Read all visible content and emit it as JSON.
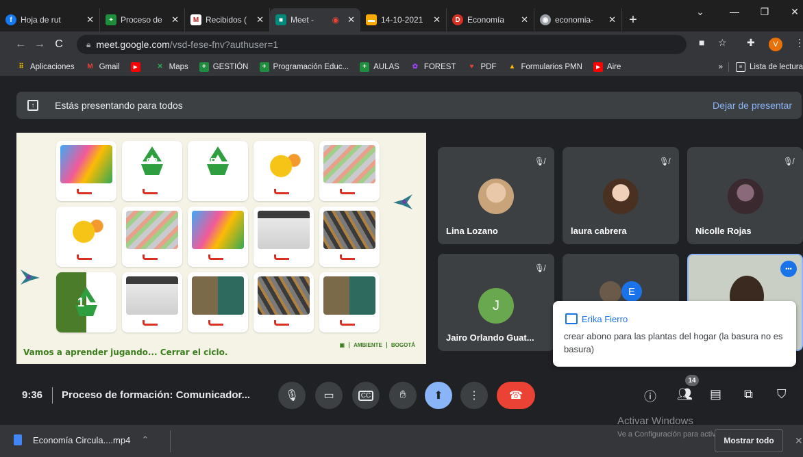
{
  "browser": {
    "tabs": [
      {
        "title": "Hoja de rut",
        "icon": "facebook-icon",
        "color": "#1877f2",
        "glyph": "f"
      },
      {
        "title": "Proceso de",
        "icon": "classroom-icon",
        "color": "#1e8e3e",
        "glyph": "+"
      },
      {
        "title": "Recibidos (",
        "icon": "gmail-icon",
        "color": "#c5221f",
        "glyph": "M"
      },
      {
        "title": "Meet -",
        "icon": "meet-icon",
        "color": "#00897b",
        "glyph": "■",
        "active": true
      },
      {
        "title": "14-10-2021",
        "icon": "document-icon",
        "color": "#f9ab00",
        "glyph": "▬"
      },
      {
        "title": "Economía",
        "icon": "d-icon",
        "color": "#d93025",
        "glyph": "D"
      },
      {
        "title": "economia-",
        "icon": "web-icon",
        "color": "#9aa0a6",
        "glyph": "◉"
      }
    ],
    "new_tab_label": "+",
    "url_host": "meet.google.com",
    "url_path": "/vsd-fese-fnv?authuser=1",
    "profile_initial": "V",
    "bookmarks": [
      {
        "label": "Aplicaciones",
        "icon": "apps-grid-icon",
        "color": "#4285f4",
        "glyph": "⠿"
      },
      {
        "label": "Gmail",
        "icon": "gmail-icon",
        "color": "#ea4335",
        "glyph": "M"
      },
      {
        "label": "",
        "icon": "youtube-icon",
        "color": "#ff0000",
        "glyph": "▶"
      },
      {
        "label": "Maps",
        "icon": "maps-icon",
        "color": "#34a853",
        "glyph": "✕"
      },
      {
        "label": "GESTIÓN",
        "icon": "classroom-icon",
        "color": "#1e8e3e",
        "glyph": "+"
      },
      {
        "label": "Programación Educ...",
        "icon": "classroom-icon",
        "color": "#1e8e3e",
        "glyph": "+"
      },
      {
        "label": "AULAS",
        "icon": "classroom-icon",
        "color": "#1e8e3e",
        "glyph": "+"
      },
      {
        "label": "FOREST",
        "icon": "forest-icon",
        "color": "#a142f4",
        "glyph": "✿"
      },
      {
        "label": "PDF",
        "icon": "pdf-icon",
        "color": "#ea4335",
        "glyph": "♥"
      },
      {
        "label": "Formularios PMN",
        "icon": "drive-icon",
        "color": "#fbbc04",
        "glyph": "▲"
      },
      {
        "label": "Aire",
        "icon": "youtube-icon",
        "color": "#ff0000",
        "glyph": "▶"
      }
    ],
    "more_bookmarks": "»",
    "reading_list": "Lista de lectura"
  },
  "meet": {
    "presenting_text": "Estás presentando para todos",
    "stop_presenting": "Dejar de presentar",
    "slide": {
      "caption": "Vamos a aprender jugando... Cerrar el ciclo.",
      "logo_ambiente": "AMBIENTE",
      "logo_bogota": "BOGOTÁ",
      "recycle_label": "9R",
      "partial_label": "1"
    },
    "participants": [
      {
        "name": "Lina Lozano",
        "muted": true
      },
      {
        "name": "laura cabrera",
        "muted": true
      },
      {
        "name": "Nicolle Rojas",
        "muted": true
      },
      {
        "name": "Jairo Orlando Guat...",
        "muted": true,
        "initial": "J"
      },
      {
        "name": "",
        "initial": "E"
      },
      {
        "name": "",
        "more": "•••"
      }
    ],
    "chat": {
      "sender": "Erika Fierro",
      "message": "crear abono para las plantas del hogar (la basura no es basura)"
    },
    "time": "9:36",
    "meeting_title": "Proceso de formación: Comunicador...",
    "people_count": "14"
  },
  "windows": {
    "activate_title": "Activar Windows",
    "activate_sub": "Ve a Configuración para activar Windows."
  },
  "downloads": {
    "file_name": "Economía Circula....mp4",
    "show_all": "Mostrar todo"
  },
  "colors": {
    "meet_bg": "#202124",
    "tile_bg": "#3c4043",
    "accent_blue": "#8ab4f8",
    "end_call": "#ea4335"
  }
}
